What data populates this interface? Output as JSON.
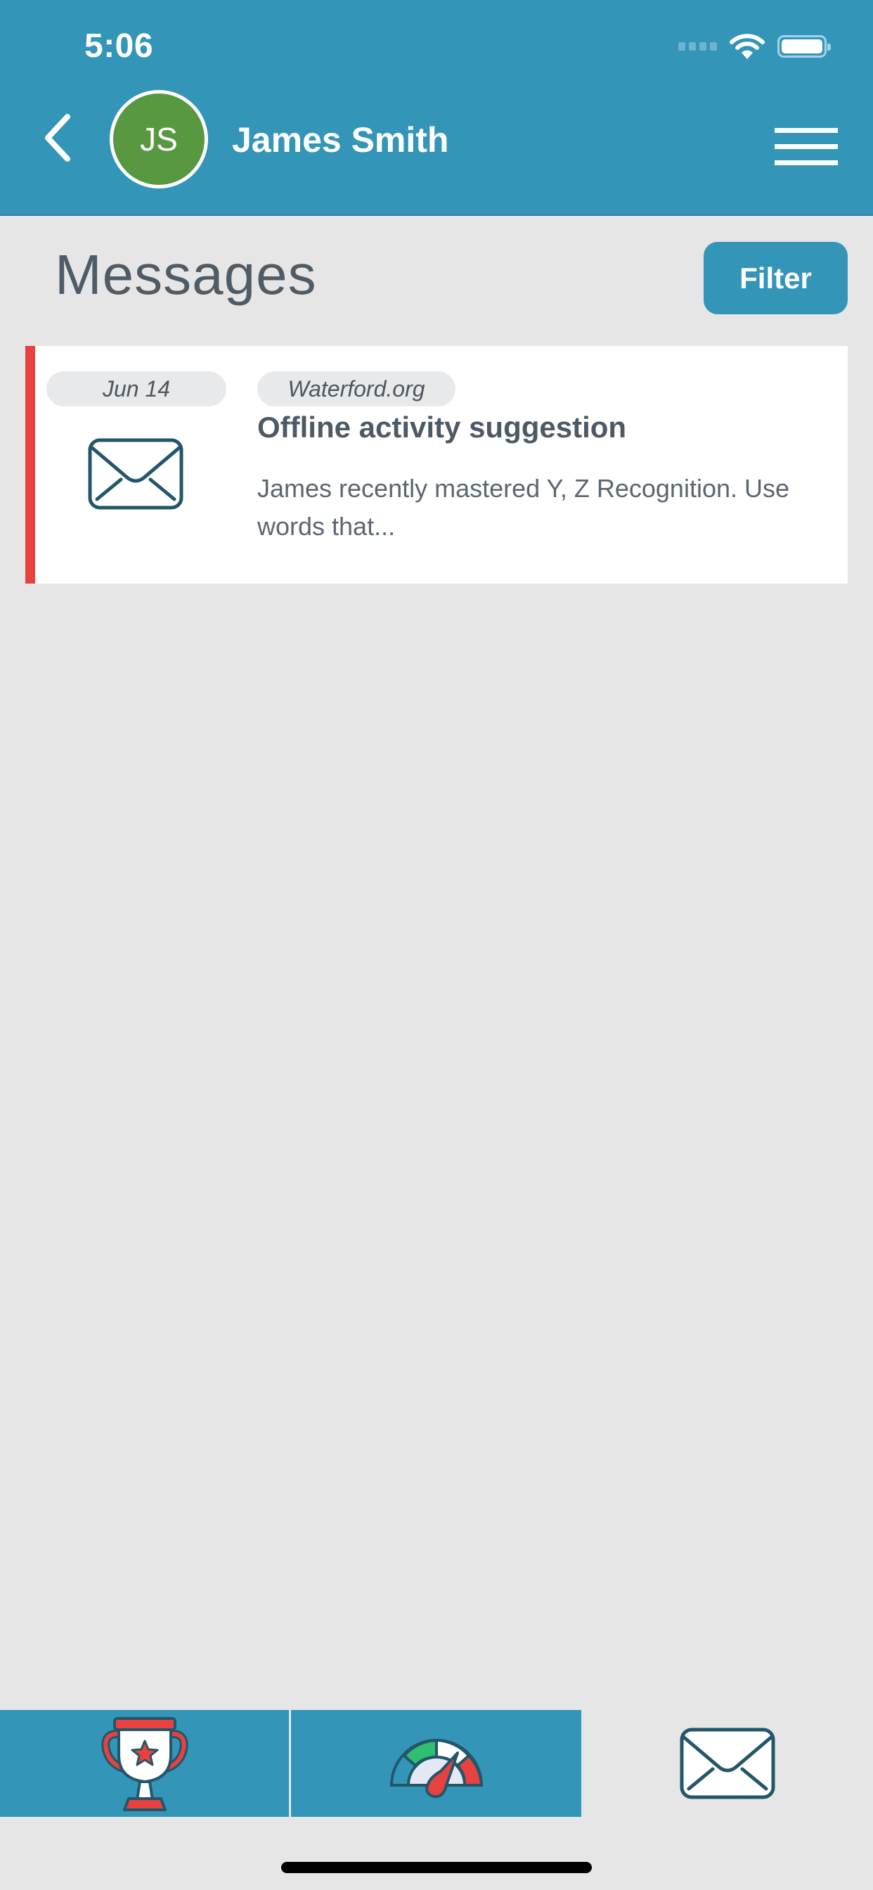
{
  "status_bar": {
    "time": "5:06",
    "icons": [
      "cellular-signal-icon",
      "wifi-icon",
      "battery-icon"
    ]
  },
  "header": {
    "back_icon": "chevron-left-icon",
    "avatar_initials": "JS",
    "user_name": "James Smith",
    "menu_icon": "hamburger-menu-icon",
    "colors": {
      "bar": "#3395b8",
      "avatar": "#589841"
    }
  },
  "page": {
    "title": "Messages",
    "filter_label": "Filter"
  },
  "messages": [
    {
      "date": "Jun 14",
      "source": "Waterford.org",
      "title": "Offline activity suggestion",
      "preview": "James recently mastered Y, Z Recognition. Use words that...",
      "icon": "envelope-icon",
      "unread_color": "#e8413f"
    }
  ],
  "tabbar": {
    "tabs": [
      {
        "icon": "trophy-icon",
        "active": false
      },
      {
        "icon": "speedometer-icon",
        "active": false
      },
      {
        "icon": "envelope-icon",
        "active": true
      }
    ]
  }
}
